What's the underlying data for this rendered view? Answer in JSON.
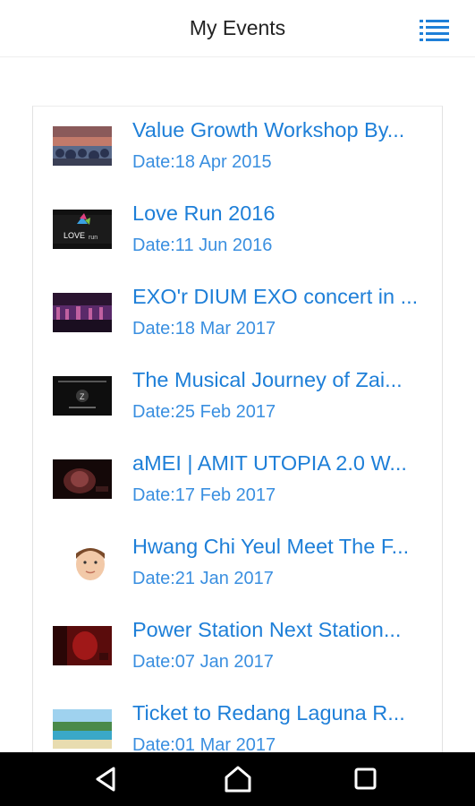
{
  "header": {
    "title": "My Events",
    "menu_icon": "list-menu-icon"
  },
  "colors": {
    "accent": "#1e7fd8",
    "date_text": "#3a8fe0",
    "nav_bar": "#000000"
  },
  "events": [
    {
      "title": "Value Growth Workshop By...",
      "date": "Date:18 Apr 2015",
      "thumb_icon": "crowd-photo-thumbnail"
    },
    {
      "title": "Love Run 2016",
      "date": "Date:11 Jun 2016",
      "thumb_icon": "love-run-logo-thumbnail"
    },
    {
      "title": "EXO'r DIUM EXO concert in ...",
      "date": "Date:18 Mar 2017",
      "thumb_icon": "concert-stage-thumbnail"
    },
    {
      "title": "The Musical Journey of Zai...",
      "date": "Date:25 Feb 2017",
      "thumb_icon": "musical-poster-thumbnail"
    },
    {
      "title": "aMEI | AMIT UTOPIA 2.0 W...",
      "date": "Date:17 Feb 2017",
      "thumb_icon": "dark-concert-thumbnail"
    },
    {
      "title": "Hwang Chi Yeul Meet The F...",
      "date": "Date:21 Jan 2017",
      "thumb_icon": "artist-face-thumbnail"
    },
    {
      "title": "Power Station Next Station...",
      "date": "Date:07 Jan 2017",
      "thumb_icon": "red-poster-thumbnail"
    },
    {
      "title": "Ticket to Redang Laguna R...",
      "date": "Date:01 Mar 2017",
      "thumb_icon": "beach-resort-thumbnail"
    }
  ],
  "nav": {
    "back_icon": "back-triangle-icon",
    "home_icon": "home-icon",
    "recents_icon": "recents-square-icon"
  }
}
